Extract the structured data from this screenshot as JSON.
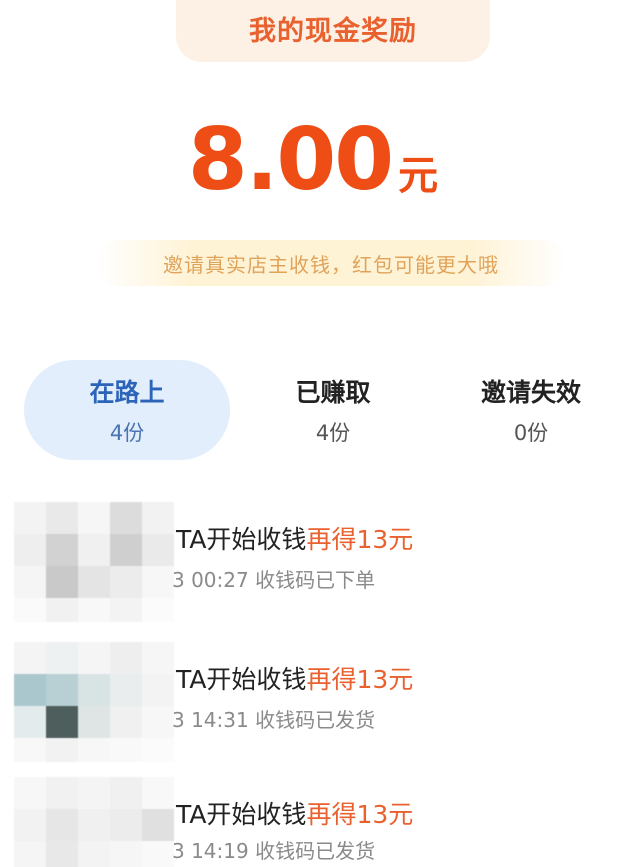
{
  "header": {
    "title": "我的现金奖励"
  },
  "reward": {
    "amount": "8.00",
    "unit": "元"
  },
  "tip": "邀请真实店主收钱，红包可能更大哦",
  "tabs": [
    {
      "label": "在路上",
      "count": "4份",
      "active": true
    },
    {
      "label": "已赚取",
      "count": "4份",
      "active": false
    },
    {
      "label": "邀请失效",
      "count": "0份",
      "active": false
    }
  ],
  "list": [
    {
      "title": "TA开始收钱",
      "bonus": "再得13元",
      "time": "3 00:27",
      "status": "收钱码已下单"
    },
    {
      "title": "TA开始收钱",
      "bonus": "再得13元",
      "time": "3 14:31",
      "status": "收钱码已发货"
    },
    {
      "title": "TA开始收钱",
      "bonus": "再得13元",
      "time": "3 14:19",
      "status": "收钱码已发货"
    }
  ],
  "colors": {
    "accent": "#ee4d16",
    "active_tab_bg": "#e2eefb",
    "active_tab_text": "#2b64b8",
    "tip_text": "#e0a35a"
  }
}
